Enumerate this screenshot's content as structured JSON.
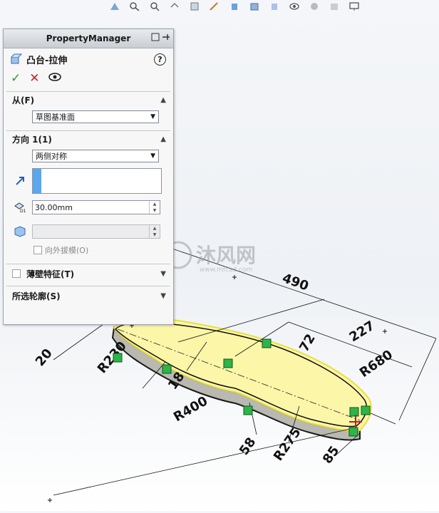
{
  "property_manager": {
    "title": "PropertyManager",
    "feature_name": "凸台-拉伸",
    "help": "?",
    "sections": {
      "from": {
        "label": "从(F)",
        "select_value": "草图基准面"
      },
      "direction1": {
        "label": "方向 1(1)",
        "select_value": "两侧对称",
        "depth_value": "30.00mm",
        "draft_label": "向外拔模(O)"
      },
      "thin": {
        "label": "薄壁特征(T)"
      },
      "contours": {
        "label": "所选轮廓(S)"
      }
    }
  },
  "dimensions": {
    "d490": "490",
    "d227": "227",
    "d72": "72",
    "r680": "R680",
    "r230": "R230",
    "d20": "20",
    "d18": "18",
    "r400": "R400",
    "d58": "58",
    "r275": "R275",
    "d85": "85"
  },
  "watermark": {
    "text": "沐风网",
    "url": "www.mfcad.com"
  },
  "colors": {
    "part_fill": "#fbf6a8",
    "part_edge": "#e8df3c",
    "relation_green": "#2fb34a"
  }
}
